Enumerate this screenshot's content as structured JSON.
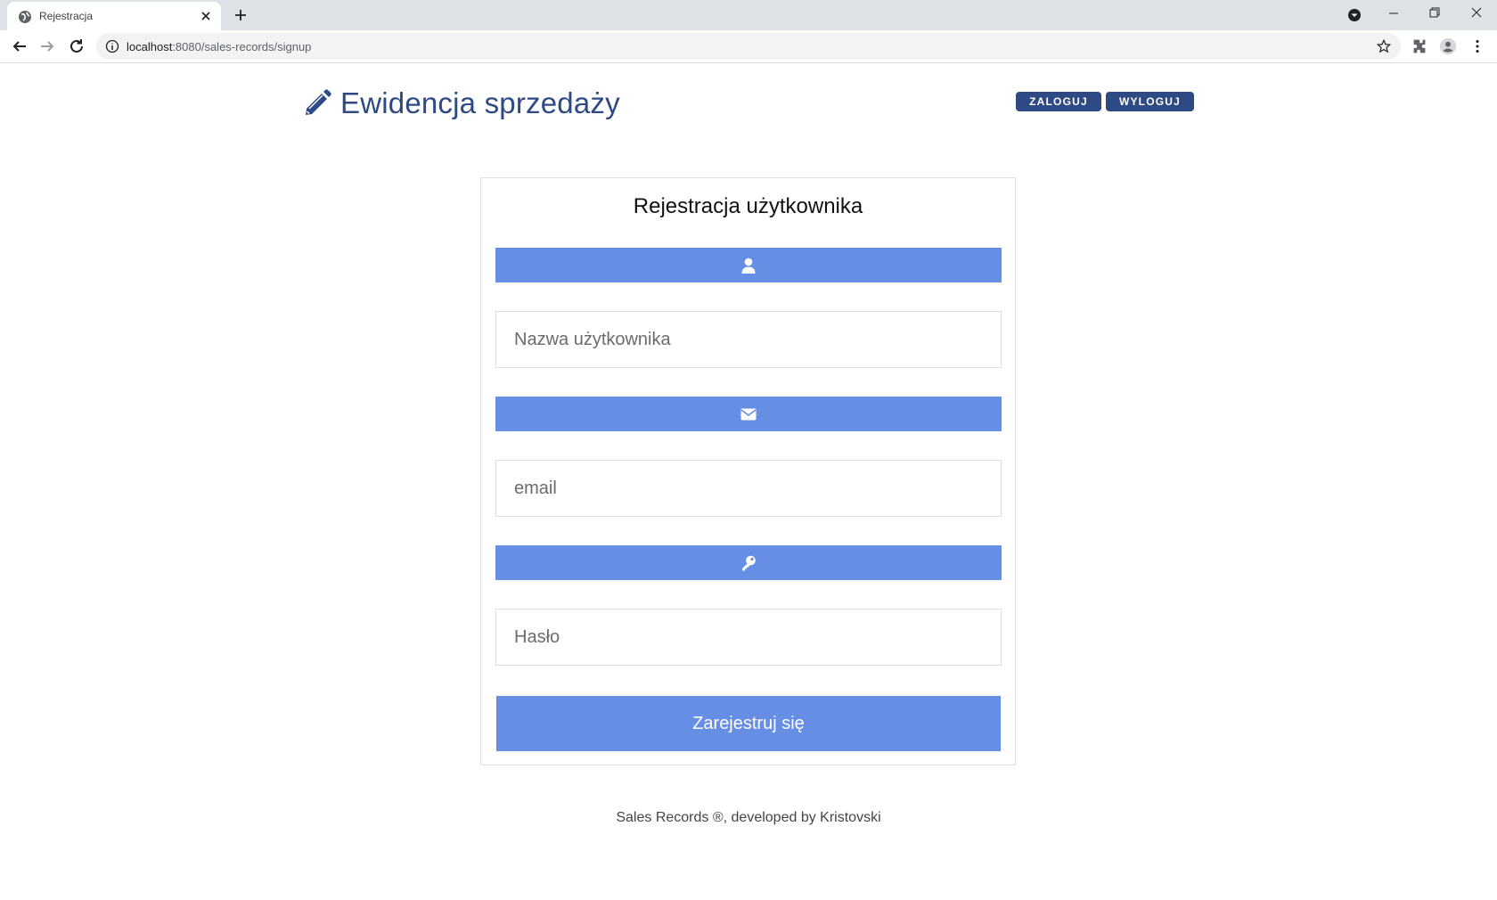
{
  "browser": {
    "tab_title": "Rejestracja",
    "url_host": "localhost",
    "url_path": ":8080/sales-records/signup"
  },
  "header": {
    "brand_icon": "pencil-icon",
    "brand_title": "Ewidencja sprzedaży",
    "login_label": "ZALOGUJ",
    "logout_label": "WYLOGUJ"
  },
  "form": {
    "title": "Rejestracja użytkownika",
    "username": {
      "icon": "user-icon",
      "placeholder": "Nazwa użytkownika",
      "value": ""
    },
    "email": {
      "icon": "envelope-icon",
      "placeholder": "email",
      "value": ""
    },
    "password": {
      "icon": "key-icon",
      "placeholder": "Hasło",
      "value": ""
    },
    "submit_label": "Zarejestruj się"
  },
  "footer": {
    "text": "Sales Records ®, developed by Kristovski"
  },
  "colors": {
    "brand": "#2e4a84",
    "accent": "#678ee5",
    "border": "#e0e0e0"
  }
}
